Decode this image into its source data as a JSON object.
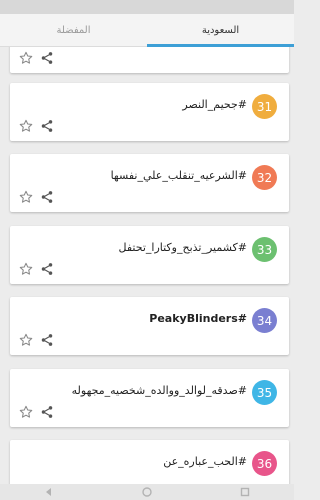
{
  "tabs": [
    {
      "label": "السعودية",
      "active": true
    },
    {
      "label": "المفضلة",
      "active": false
    }
  ],
  "colors": {
    "accent": "#3d9fd6"
  },
  "cards": [
    {
      "number": "",
      "title": "",
      "badge_color": ""
    },
    {
      "number": "31",
      "title": "#جحيم_النصر",
      "badge_color": "#f0ad3e"
    },
    {
      "number": "32",
      "title": "#الشرعيه_تنقلب_علي_نفسها",
      "badge_color": "#f07a55"
    },
    {
      "number": "33",
      "title": "#كشمير_تذبح_وكتارا_تحتفل",
      "badge_color": "#6cc070"
    },
    {
      "number": "34",
      "title": "#PeakyBlinders",
      "badge_color": "#7a7fd1"
    },
    {
      "number": "35",
      "title": "#صدقه_لوالد_ووالده_شخصيه_مجهوله",
      "badge_color": "#3fb6e6"
    },
    {
      "number": "36",
      "title": "#الحب_عباره_عن",
      "badge_color": "#e8558a"
    }
  ],
  "icons": {
    "star": "star-outline-icon",
    "share": "share-icon"
  }
}
